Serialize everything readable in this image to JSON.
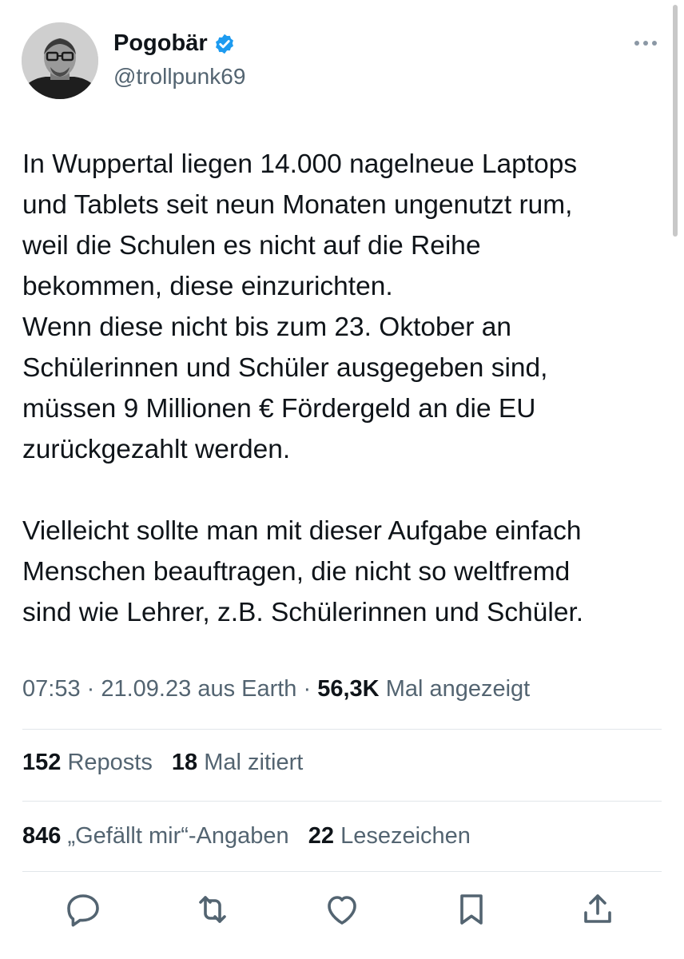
{
  "user": {
    "display_name": "Pogobär",
    "handle": "@trollpunk69",
    "verified": true
  },
  "tweet": {
    "lines": [
      "In Wuppertal liegen 14.000 nagelneue Laptops",
      "und Tablets seit neun Monaten ungenutzt rum,",
      "weil die Schulen es nicht auf die Reihe",
      "bekommen, diese einzurichten.",
      "Wenn diese nicht bis zum 23. Oktober an",
      "Schülerinnen und Schüler ausgegeben sind,",
      "müssen 9 Millionen € Fördergeld an die EU",
      "zurückgezahlt werden.",
      "",
      "Vielleicht sollte man mit dieser Aufgabe einfach",
      "Menschen beauftragen, die nicht so weltfremd",
      "sind wie Lehrer, z.B. Schülerinnen und Schüler."
    ]
  },
  "meta": {
    "time": "07:53",
    "date": "21.09.23",
    "source": "aus Earth",
    "views_count": "56,3K",
    "views_label": "Mal angezeigt"
  },
  "stats": {
    "reposts_count": "152",
    "reposts_label": "Reposts",
    "quotes_count": "18",
    "quotes_label": "Mal zitiert",
    "likes_count": "846",
    "likes_label": "„Gefällt mir“-Angaben",
    "bookmarks_count": "22",
    "bookmarks_label": "Lesezeichen"
  },
  "colors": {
    "text": "#0f1419",
    "secondary": "#536471",
    "verified": "#1d9bf0",
    "divider": "#e1e6ea"
  },
  "icons": [
    "reply-icon",
    "repost-icon",
    "like-icon",
    "bookmark-icon",
    "share-icon"
  ]
}
